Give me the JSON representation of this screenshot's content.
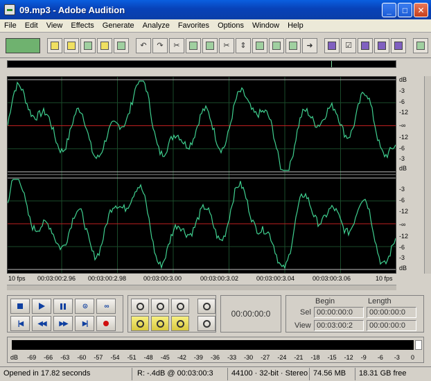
{
  "window": {
    "title": "09.mp3 - Adobe Audition",
    "min": "_",
    "max": "□",
    "close": "✕"
  },
  "menu": [
    "File",
    "Edit",
    "View",
    "Effects",
    "Generate",
    "Analyze",
    "Favorites",
    "Options",
    "Window",
    "Help"
  ],
  "waveform": {
    "db_top_channel": [
      "dB",
      "-3",
      "-6",
      "-12",
      "-∞",
      "-12",
      "-6",
      "-3",
      "dB"
    ],
    "db_bottom_channel": [
      "-3",
      "-6",
      "-12",
      "-∞",
      "-12",
      "-6",
      "-3",
      "dB"
    ],
    "colors": {
      "wave": "#3fcf8f",
      "center": "#c02020",
      "grid": "#1a4a2a",
      "bg": "#000000"
    }
  },
  "time_ruler": [
    "10 fps",
    "00:03:00:2.96",
    "00:03:00:2.98",
    "00:03:00:3.00",
    "00:03:00:3.02",
    "00:03:00:3.04",
    "00:03:00:3.06",
    "10 fps"
  ],
  "transport": {
    "time_display": "00:00:00:0"
  },
  "selection": {
    "begin_label": "Begin",
    "length_label": "Length",
    "sel_label": "Sel",
    "view_label": "View",
    "sel_begin": "00:00:00:0",
    "sel_length": "00:00:00:0",
    "view_begin": "00:03:00:2",
    "view_length": "00:00:00:0"
  },
  "meter_scale": [
    "dB",
    "-69",
    "-66",
    "-63",
    "-60",
    "-57",
    "-54",
    "-51",
    "-48",
    "-45",
    "-42",
    "-39",
    "-36",
    "-33",
    "-30",
    "-27",
    "-24",
    "-21",
    "-18",
    "-15",
    "-12",
    "-9",
    "-6",
    "-3",
    "0"
  ],
  "status": {
    "opened": "Opened in 17.82 seconds",
    "cursor": "R: -.4dB @ 00:03:00:3",
    "format": "44100 · 32-bit · Stereo",
    "size": "74.56 MB",
    "free": "18.31 GB free"
  }
}
